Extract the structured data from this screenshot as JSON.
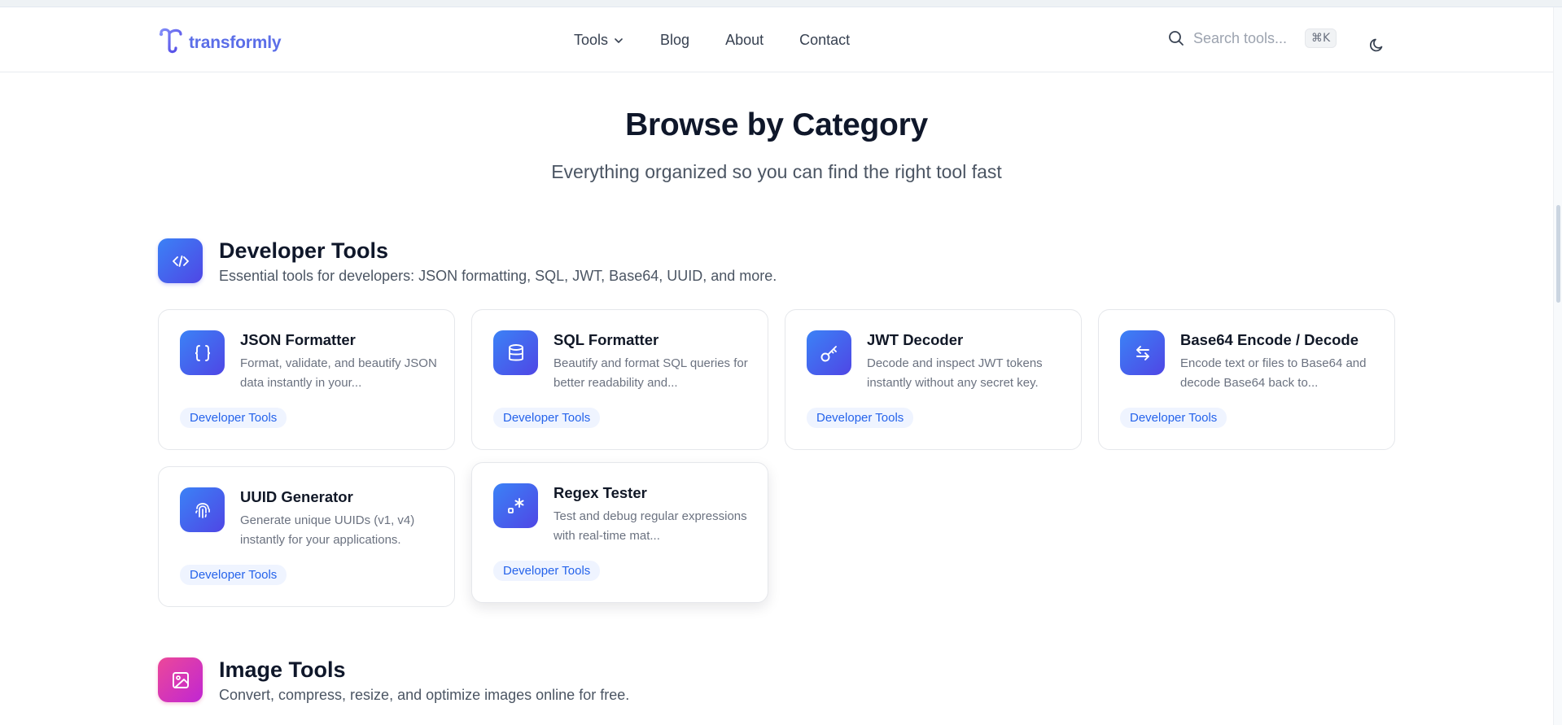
{
  "header": {
    "brand": "transformly",
    "nav": [
      {
        "label": "Tools",
        "has_dropdown": true
      },
      {
        "label": "Blog"
      },
      {
        "label": "About"
      },
      {
        "label": "Contact"
      }
    ],
    "search": {
      "placeholder": "Search tools...",
      "shortcut": "⌘K"
    },
    "theme_icon": "moon-icon"
  },
  "hero": {
    "title": "Browse by Category",
    "subtitle": "Everything organized so you can find the right tool fast"
  },
  "categories": [
    {
      "title": "Developer Tools",
      "description": "Essential tools for developers: JSON formatting, SQL, JWT, Base64, UUID, and more.",
      "icon": "code-icon",
      "accent": "#4f46e5",
      "tools": [
        {
          "title": "JSON Formatter",
          "description": "Format, validate, and beautify JSON data instantly in your...",
          "badge": "Developer Tools",
          "icon": "braces-icon"
        },
        {
          "title": "SQL Formatter",
          "description": "Beautify and format SQL queries for better readability and...",
          "badge": "Developer Tools",
          "icon": "database-icon"
        },
        {
          "title": "JWT Decoder",
          "description": "Decode and inspect JWT tokens instantly without any secret key.",
          "badge": "Developer Tools",
          "icon": "key-icon"
        },
        {
          "title": "Base64 Encode / Decode",
          "description": "Encode text or files to Base64 and decode Base64 back to...",
          "badge": "Developer Tools",
          "icon": "arrows-swap-icon"
        },
        {
          "title": "UUID Generator",
          "description": "Generate unique UUIDs (v1, v4) instantly for your applications.",
          "badge": "Developer Tools",
          "icon": "fingerprint-icon"
        },
        {
          "title": "Regex Tester",
          "description": "Test and debug regular expressions with real-time mat...",
          "badge": "Developer Tools",
          "icon": "regex-icon"
        }
      ]
    },
    {
      "title": "Image Tools",
      "description": "Convert, compress, resize, and optimize images online for free.",
      "icon": "image-icon",
      "accent": "#db2777"
    }
  ],
  "colors": {
    "brand": "#5b6ee8",
    "badge_text": "#2563eb",
    "badge_bg": "#eff4ff"
  }
}
